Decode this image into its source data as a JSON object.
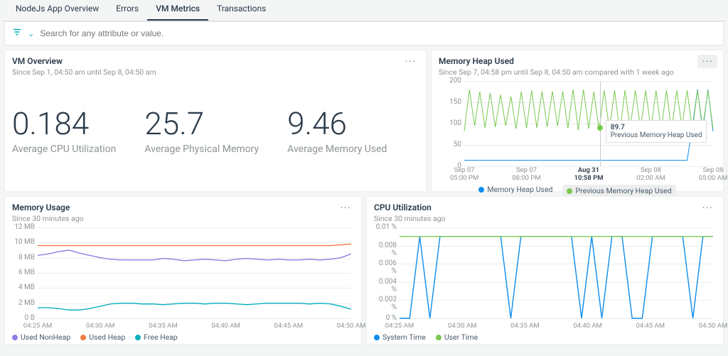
{
  "tabs": [
    "NodeJs App Overview",
    "Errors",
    "VM Metrics",
    "Transactions"
  ],
  "active_tab": 2,
  "search": {
    "placeholder": "Search for any attribute or value."
  },
  "colors": {
    "teal": "#0ab0bf",
    "blue": "#0d8ceb",
    "green": "#7bc950",
    "orange": "#f07c3e",
    "purple": "#8f7ee6",
    "grid": "#eceded"
  },
  "vm_overview": {
    "title": "VM Overview",
    "subtitle": "Since Sep 1, 04:50 am until Sep 8, 04:50 am",
    "metrics": [
      {
        "value": "0.184",
        "label": "Average CPU Utilization"
      },
      {
        "value": "25.7",
        "label": "Average Physical Memory"
      },
      {
        "value": "9.46",
        "label": "Average Memory Used"
      }
    ]
  },
  "memory_heap": {
    "title": "Memory Heap Used",
    "subtitle": "Since Sep 7, 04:58 pm until Sep 8, 04:50 am compared with 1 week ago",
    "legend": [
      "Memory Heap Used",
      "Previous Memory Heap Used"
    ],
    "marker": {
      "value": "89.7",
      "label": "Previous Memory Heap Used",
      "hover_x": "Aug 31, 10:58 PM"
    },
    "chart_data": {
      "type": "line",
      "ylim": [
        0,
        200
      ],
      "yticks": [
        0,
        50,
        100,
        150,
        200
      ],
      "xticks": [
        "Sep 07, 05:00 PM",
        "Sep 07, 08:00 PM",
        "Aug 31, 10:58 PM",
        "Sep 08, 02:00 AM",
        "Sep 08, 05:00 AM"
      ],
      "series": [
        {
          "name": "Memory Heap Used",
          "color": "#0d8ceb",
          "values": [
            14,
            14,
            14,
            14,
            14,
            14,
            14,
            14,
            14,
            14,
            14,
            14,
            14,
            14,
            14,
            14,
            14,
            14,
            14,
            14,
            14,
            14,
            14,
            14,
            14,
            14,
            14,
            14,
            14,
            14,
            14,
            14,
            14,
            14,
            14,
            14,
            14,
            14,
            14,
            14,
            14,
            14,
            14,
            14,
            92,
            180,
            82,
            180,
            82
          ]
        },
        {
          "name": "Previous Memory Heap Used",
          "color": "#7bc950",
          "values": [
            82,
            180,
            95,
            175,
            90,
            172,
            92,
            168,
            95,
            164,
            88,
            175,
            90,
            178,
            90,
            176,
            92,
            176,
            94,
            176,
            89,
            180,
            85,
            180,
            88,
            175,
            85,
            178,
            85,
            178,
            80,
            178,
            90,
            178,
            88,
            178,
            88,
            178,
            85,
            178,
            85,
            178,
            92,
            178,
            85,
            178,
            90,
            178,
            88
          ]
        }
      ]
    }
  },
  "memory_usage": {
    "title": "Memory Usage",
    "subtitle": "Since 30 minutes ago",
    "legend": [
      "Used NonHeap",
      "Used Heap",
      "Free Heap"
    ],
    "chart_data": {
      "type": "line",
      "ylim": [
        0,
        12
      ],
      "yticks": [
        "0 B",
        "2 MB",
        "4 MB",
        "6 MB",
        "8 MB",
        "10 MB",
        "12 MB"
      ],
      "xticks": [
        "04:25 AM",
        "04:30 AM",
        "04:35 AM",
        "04:40 AM",
        "04:45 AM",
        "04:50 AM"
      ],
      "series": [
        {
          "name": "Used NonHeap",
          "color": "#8f7ee6",
          "values": [
            8.3,
            8.5,
            8.8,
            9.0,
            8.6,
            8.3,
            8.0,
            7.8,
            7.7,
            7.7,
            7.7,
            7.7,
            7.9,
            7.8,
            7.6,
            7.7,
            7.8,
            7.7,
            7.6,
            7.8,
            7.9,
            7.8,
            7.7,
            7.8,
            7.7,
            7.7,
            7.8,
            7.7,
            7.8,
            8.0,
            8.5
          ]
        },
        {
          "name": "Used Heap",
          "color": "#f07c3e",
          "values": [
            9.6,
            9.6,
            9.6,
            9.6,
            9.6,
            9.6,
            9.6,
            9.6,
            9.6,
            9.6,
            9.6,
            9.6,
            9.6,
            9.6,
            9.6,
            9.6,
            9.6,
            9.6,
            9.6,
            9.6,
            9.6,
            9.6,
            9.6,
            9.6,
            9.6,
            9.6,
            9.6,
            9.6,
            9.6,
            9.7,
            9.8
          ]
        },
        {
          "name": "Free Heap",
          "color": "#0ab0bf",
          "values": [
            1.4,
            1.4,
            1.3,
            1.1,
            1.1,
            1.3,
            1.6,
            1.9,
            2.0,
            2.0,
            1.9,
            1.9,
            1.8,
            1.9,
            2.0,
            2.0,
            1.9,
            2.0,
            2.0,
            1.9,
            1.8,
            1.9,
            2.0,
            2.0,
            2.0,
            2.0,
            1.9,
            2.0,
            1.9,
            1.6,
            1.2
          ]
        }
      ]
    }
  },
  "cpu_util": {
    "title": "CPU Utilization",
    "subtitle": "Since 30 minutes ago",
    "legend": [
      "System Time",
      "User Time"
    ],
    "chart_data": {
      "type": "line",
      "ylim": [
        0,
        0.01
      ],
      "yticks": [
        "0 %",
        "0.002 %",
        "0.004 %",
        "0.006 %",
        "0.008 %",
        "0.01 %"
      ],
      "xticks": [
        "04:25 AM",
        "04:30 AM",
        "04:35 AM",
        "04:40 AM",
        "04:45 AM",
        "04:50 AM"
      ],
      "series": [
        {
          "name": "System Time",
          "color": "#0d8ceb",
          "values": [
            0,
            0,
            0.009,
            0,
            0.009,
            0.009,
            0.009,
            0.009,
            0.009,
            0.009,
            0.009,
            0,
            0.009,
            0.009,
            0.009,
            0.009,
            0.009,
            0.009,
            0,
            0.009,
            0,
            0.009,
            0.009,
            0,
            0,
            0.009,
            0.009,
            0.009,
            0.009,
            0,
            0.009,
            0.009
          ]
        },
        {
          "name": "User Time",
          "color": "#7bc950",
          "values": [
            0.009,
            0.009,
            0.009,
            0.009,
            0.009,
            0.009,
            0.009,
            0.009,
            0.009,
            0.009,
            0.009,
            0.009,
            0.009,
            0.009,
            0.009,
            0.009,
            0.009,
            0.009,
            0.009,
            0.009,
            0.009,
            0.009,
            0.009,
            0.009,
            0.009,
            0.009,
            0.009,
            0.009,
            0.009,
            0.009,
            0.009,
            0.009
          ]
        }
      ]
    }
  }
}
